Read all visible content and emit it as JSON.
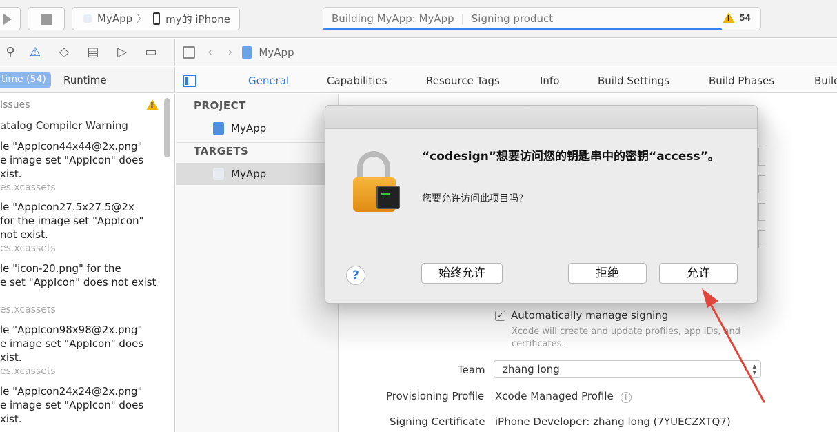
{
  "toolbar": {
    "scheme_app": "MyApp",
    "scheme_device": "my的 iPhone",
    "activity_status": "Building MyApp: MyApp",
    "activity_step": "Signing product",
    "warning_count": "54"
  },
  "navigator": {
    "tab_buildtime": "time (54)",
    "tab_runtime": "Runtime",
    "issues_header": "Issues",
    "category": "atalog Compiler Warning",
    "issues": [
      {
        "lines": [
          "le \"AppIcon44x44@2x.png\"",
          "e image set \"AppIcon\" does",
          "xist."
        ],
        "file": "es.xcassets"
      },
      {
        "lines": [
          "le \"AppIcon27.5x27.5@2x",
          " for the image set \"AppIcon\"",
          "not exist."
        ],
        "file": "es.xcassets"
      },
      {
        "lines": [
          "le \"icon-20.png\" for the",
          "e set \"AppIcon\" does not exist",
          ""
        ],
        "file": "es.xcassets"
      },
      {
        "lines": [
          "le \"AppIcon98x98@2x.png\"",
          "e image set \"AppIcon\" does",
          "xist."
        ],
        "file": "es.xcassets"
      },
      {
        "lines": [
          "le \"AppIcon24x24@2x.png\"",
          "e image set \"AppIcon\" does",
          "xist."
        ],
        "file": ""
      }
    ]
  },
  "editor": {
    "breadcrumb": "MyApp",
    "tabs": [
      "General",
      "Capabilities",
      "Resource Tags",
      "Info",
      "Build Settings",
      "Build Phases",
      "Build"
    ],
    "project_label": "PROJECT",
    "project_name": "MyApp",
    "targets_label": "TARGETS",
    "target_name": "MyApp"
  },
  "signing": {
    "auto_manage_label": "Automatically manage signing",
    "auto_manage_checked": true,
    "auto_manage_note": "Xcode will create and update profiles, app IDs, and certificates.",
    "team_label": "Team",
    "team_value": "zhang long",
    "profile_label": "Provisioning Profile",
    "profile_value": "Xcode Managed Profile",
    "cert_label": "Signing Certificate",
    "cert_value": "iPhone Developer: zhang long (7YUECZXTQ7)"
  },
  "dialog": {
    "title": "“codesign”想要访问您的钥匙串中的密钥“access”。",
    "message": "您要允许访问此项目吗?",
    "help_label": "?",
    "btn_always_allow": "始终允许",
    "btn_deny": "拒绝",
    "btn_allow": "允许"
  },
  "colors": {
    "accent": "#2f7ae5",
    "annotation_arrow": "#e0463a",
    "warning": "#f4b400"
  }
}
